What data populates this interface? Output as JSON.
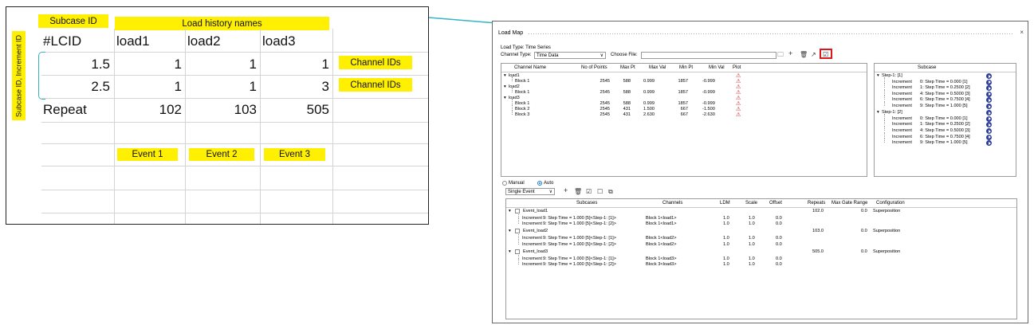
{
  "sheet": {
    "header_subcase": "Subcase ID",
    "header_history": "Load history names",
    "side_label_top": "Subcase ID, Increment ID",
    "col_headers": [
      "#LCID",
      "load1",
      "load2",
      "load3"
    ],
    "rows": [
      {
        "id": "1.5",
        "v": [
          "1",
          "1",
          "1"
        ],
        "tag": "Channel IDs"
      },
      {
        "id": "2.5",
        "v": [
          "1",
          "1",
          "3"
        ],
        "tag": "Channel IDs"
      }
    ],
    "repeat": {
      "label": "Repeat",
      "v": [
        "102",
        "103",
        "505"
      ]
    },
    "events": [
      "Event 1",
      "Event 2",
      "Event 3"
    ],
    "accent": "#ffef00",
    "connector_color": "#35b4c4"
  },
  "window": {
    "title": "Load Map",
    "close": "×",
    "load_type": "Load Type: Time Series",
    "channel_type_label": "Channel Type:",
    "channel_type_value": "Time Data",
    "choose_file_label": "Choose File:",
    "highlight_color": "#e0141b",
    "channels_table": {
      "headers": [
        "Channel Name",
        "No of Points",
        "Max Pt",
        "Max Val",
        "Min Pt",
        "Min Val",
        "Plot"
      ],
      "rows": [
        {
          "name": "load1",
          "group": true
        },
        {
          "name": "Block 1",
          "pts": "2545",
          "maxpt": "588",
          "maxval": "0.999",
          "minpt": "1857",
          "minval": "-0.999"
        },
        {
          "name": "load2",
          "group": true
        },
        {
          "name": "Block 1",
          "pts": "2545",
          "maxpt": "588",
          "maxval": "0.999",
          "minpt": "1857",
          "minval": "-0.999"
        },
        {
          "name": "load3",
          "group": true
        },
        {
          "name": "Block 1",
          "pts": "2545",
          "maxpt": "588",
          "maxval": "0.999",
          "minpt": "1857",
          "minval": "-0.999"
        },
        {
          "name": "Block 2",
          "pts": "2545",
          "maxpt": "431",
          "maxval": "1.500",
          "minpt": "667",
          "minval": "-1.500"
        },
        {
          "name": "Block 3",
          "pts": "2545",
          "maxpt": "431",
          "maxval": "2.630",
          "minpt": "667",
          "minval": "-2.630"
        }
      ]
    },
    "subcase_panel": {
      "header": "Subcase",
      "steps": [
        {
          "name": "Step-1: [1]",
          "incs": [
            {
              "label": "Increment",
              "val": "0: Step Time =  0.000 [1]"
            },
            {
              "label": "Increment",
              "val": "1: Step Time =  0.2500 [2]"
            },
            {
              "label": "Increment",
              "val": "4: Step Time =  0.5000 [3]"
            },
            {
              "label": "Increment",
              "val": "6: Step Time =  0.7500 [4]"
            },
            {
              "label": "Increment",
              "val": "9: Step Time =  1.000 [5]"
            }
          ]
        },
        {
          "name": "Step-1: [2]",
          "incs": [
            {
              "label": "Increment",
              "val": "0: Step Time =  0.000 [1]"
            },
            {
              "label": "Increment",
              "val": "1: Step Time =  0.2500 [2]"
            },
            {
              "label": "Increment",
              "val": "4: Step Time =  0.5000 [3]"
            },
            {
              "label": "Increment",
              "val": "6: Step Time =  0.7500 [4]"
            },
            {
              "label": "Increment",
              "val": "9: Step Time =  1.000 [5]"
            }
          ]
        }
      ]
    },
    "mode_manual": "Manual",
    "mode_auto": "Auto",
    "event_mode": "Single Event",
    "events_table": {
      "headers": [
        "Subcases",
        "Channels",
        "LDM",
        "Scale",
        "Offset",
        "Repeats",
        "Max Gate Range",
        "Configuration"
      ],
      "events": [
        {
          "name": "Event_load1",
          "repeats": "102.0",
          "gate": "0.0",
          "config": "Superposition",
          "rows": [
            {
              "label": "Increment",
              "sub": "9: Step Time =  1.000 [5]<Step-1: [1]>",
              "ch": "Block 1<load1>",
              "ldm": "1.0",
              "scale": "1.0",
              "offset": "0.0"
            },
            {
              "label": "Increment",
              "sub": "9: Step Time =  1.000 [5]<Step-1: [2]>",
              "ch": "Block 1<load1>",
              "ldm": "1.0",
              "scale": "1.0",
              "offset": "0.0"
            }
          ]
        },
        {
          "name": "Event_load2",
          "repeats": "103.0",
          "gate": "0.0",
          "config": "Superposition",
          "rows": [
            {
              "label": "Increment",
              "sub": "9: Step Time =  1.000 [5]<Step-1: [1]>",
              "ch": "Block 1<load2>",
              "ldm": "1.0",
              "scale": "1.0",
              "offset": "0.0"
            },
            {
              "label": "Increment",
              "sub": "9: Step Time =  1.000 [5]<Step-1: [2]>",
              "ch": "Block 1<load2>",
              "ldm": "1.0",
              "scale": "1.0",
              "offset": "0.0"
            }
          ]
        },
        {
          "name": "Event_load3",
          "repeats": "505.0",
          "gate": "0.0",
          "config": "Superposition",
          "rows": [
            {
              "label": "Increment",
              "sub": "9: Step Time =  1.000 [5]<Step-1: [1]>",
              "ch": "Block 1<load3>",
              "ldm": "1.0",
              "scale": "1.0",
              "offset": "0.0"
            },
            {
              "label": "Increment",
              "sub": "9: Step Time =  1.000 [5]<Step-1: [2]>",
              "ch": "Block 3<load3>",
              "ldm": "1.0",
              "scale": "1.0",
              "offset": "0.0"
            }
          ]
        }
      ]
    }
  }
}
